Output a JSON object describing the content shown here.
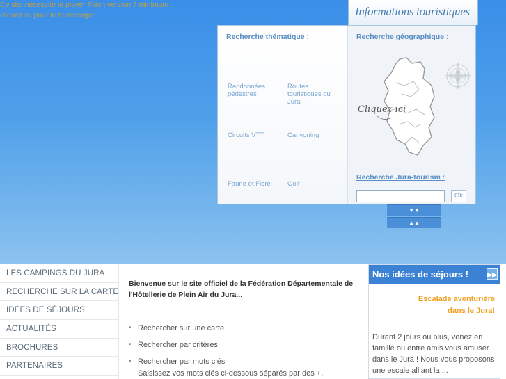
{
  "flash_notice": {
    "line1": "Ce site nécessite le player Flash version 7 minimum :",
    "line2": "cliquez ici pour le télécharger"
  },
  "info_panel": {
    "tab_title": "Informations touristiques",
    "thematic_title": "Recherche thématique :",
    "geographic_title": "Recherche géographique :",
    "themes": [
      {
        "label": "Randonnées pédestres"
      },
      {
        "label": "Routes touristiques du Jura"
      },
      {
        "label": "Circuits VTT"
      },
      {
        "label": "Canyoning"
      },
      {
        "label": "Faune et Flore"
      },
      {
        "label": "Golf"
      }
    ],
    "map_caption": "Cliquez ici",
    "search_title": "Recherche Jura-tourism :",
    "search_value": "",
    "ok_label": "Ok",
    "arrow_down": "▼▼",
    "arrow_up": "▲▲"
  },
  "sidebar": {
    "items": [
      {
        "label": "LES CAMPINGS DU JURA"
      },
      {
        "label": "RECHERCHE SUR LA CARTE"
      },
      {
        "label": "IDÉES DE SÉJOURS"
      },
      {
        "label": "ACTUALITÉS"
      },
      {
        "label": "BROCHURES"
      },
      {
        "label": "PARTENAIRES"
      }
    ]
  },
  "main": {
    "welcome_line1": "Bienvenue sur le site officiel de la Fédération Départementale de",
    "welcome_line2": "l'Hôtellerie de Plein Air du Jura...",
    "links": [
      {
        "label": "Rechercher sur une carte"
      },
      {
        "label": "Rechercher par critères"
      },
      {
        "label": "Rechercher par mots clés"
      }
    ],
    "keywords_hint": "Saisissez vos mots clés ci-dessous séparés par des +."
  },
  "ideas_box": {
    "header": "Nos idées de séjours !",
    "arrow": "▶▶",
    "title_line1": "Escalade aventurière",
    "title_line2": "dans le Jura!",
    "body": [
      "Durant 2 jours ou plus, venez en",
      "famille ou entre amis vous amuser",
      "dans le Jura ! Nous vous proposons",
      "une escale alliant la ..."
    ]
  },
  "colors": {
    "hero_top": "#3a8ee8",
    "accent_blue": "#3c82d4",
    "link_blue": "#5b8ec4",
    "orange_title": "#f0a020",
    "notice_yellow": "#b8a04a"
  }
}
